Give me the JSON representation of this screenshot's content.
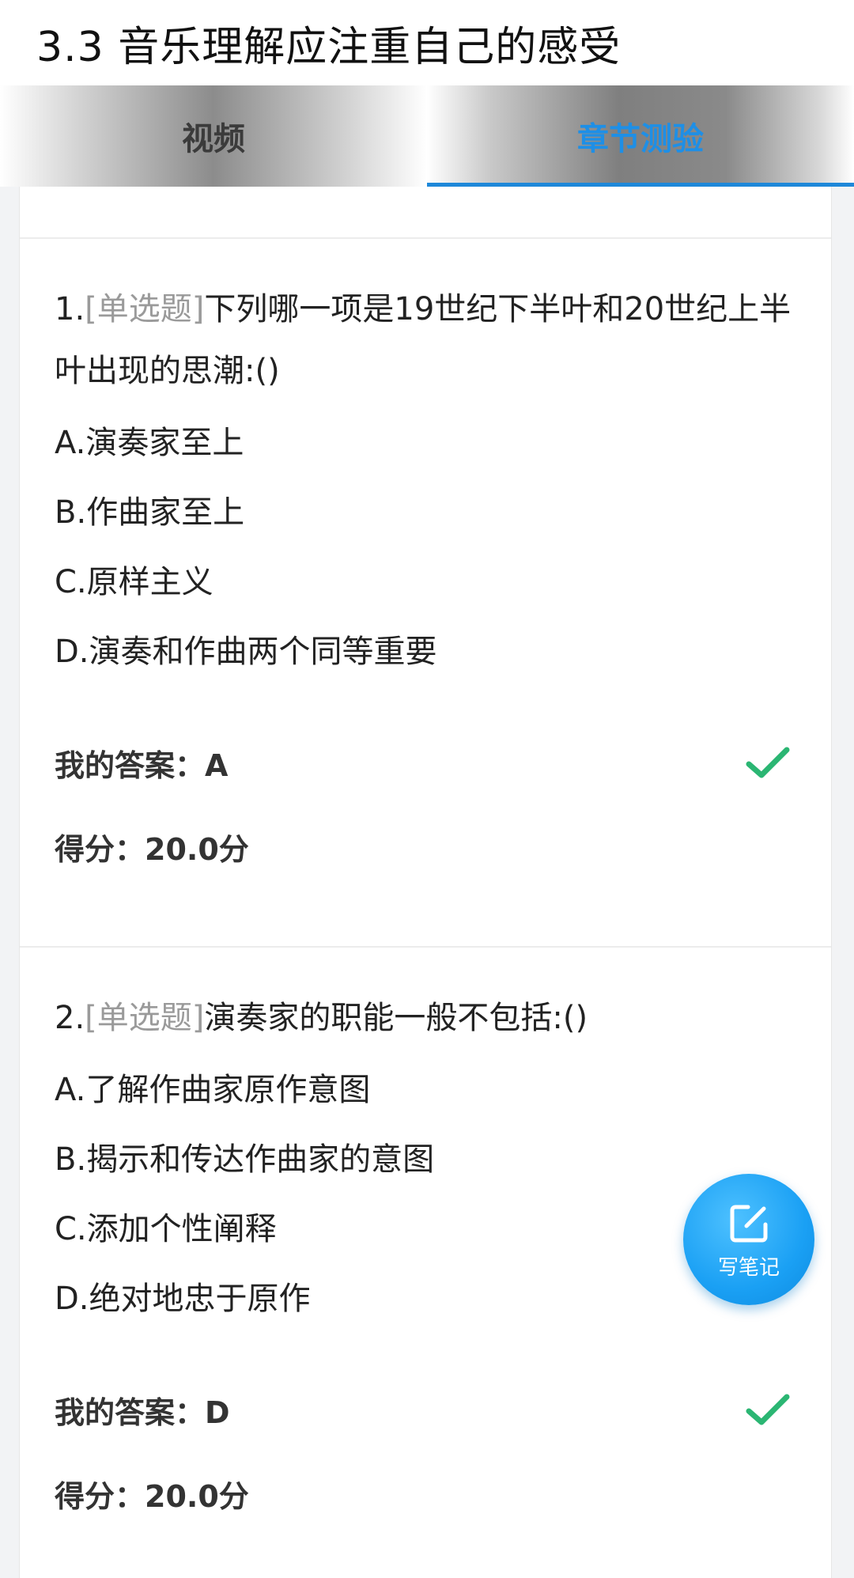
{
  "header": {
    "title": "3.3 音乐理解应注重自己的感受"
  },
  "tabs": [
    {
      "label": "视频",
      "active": false
    },
    {
      "label": "章节测验",
      "active": true
    }
  ],
  "questions": [
    {
      "number": "1.",
      "type": "[单选题]",
      "text": "下列哪一项是19世纪下半叶和20世纪上半叶出现的思潮:()",
      "options": [
        "A.演奏家至上",
        "B.作曲家至上",
        "C.原样主义",
        "D.演奏和作曲两个同等重要"
      ],
      "answer_label": "我的答案：",
      "answer_value": "A",
      "score_label": "得分：",
      "score_value": "20.0分",
      "correct": true
    },
    {
      "number": "2.",
      "type": "[单选题]",
      "text": "演奏家的职能一般不包括:()",
      "options": [
        "A.了解作曲家原作意图",
        "B.揭示和传达作曲家的意图",
        "C.添加个性阐释",
        "D.绝对地忠于原作"
      ],
      "answer_label": "我的答案：",
      "answer_value": "D",
      "score_label": "得分：",
      "score_value": "20.0分",
      "correct": true
    }
  ],
  "fab": {
    "label": "写笔记",
    "icon": "edit-note-icon"
  },
  "colors": {
    "accent": "#1e88d9",
    "check": "#2bb673",
    "question_type": "#9a9a9a"
  }
}
